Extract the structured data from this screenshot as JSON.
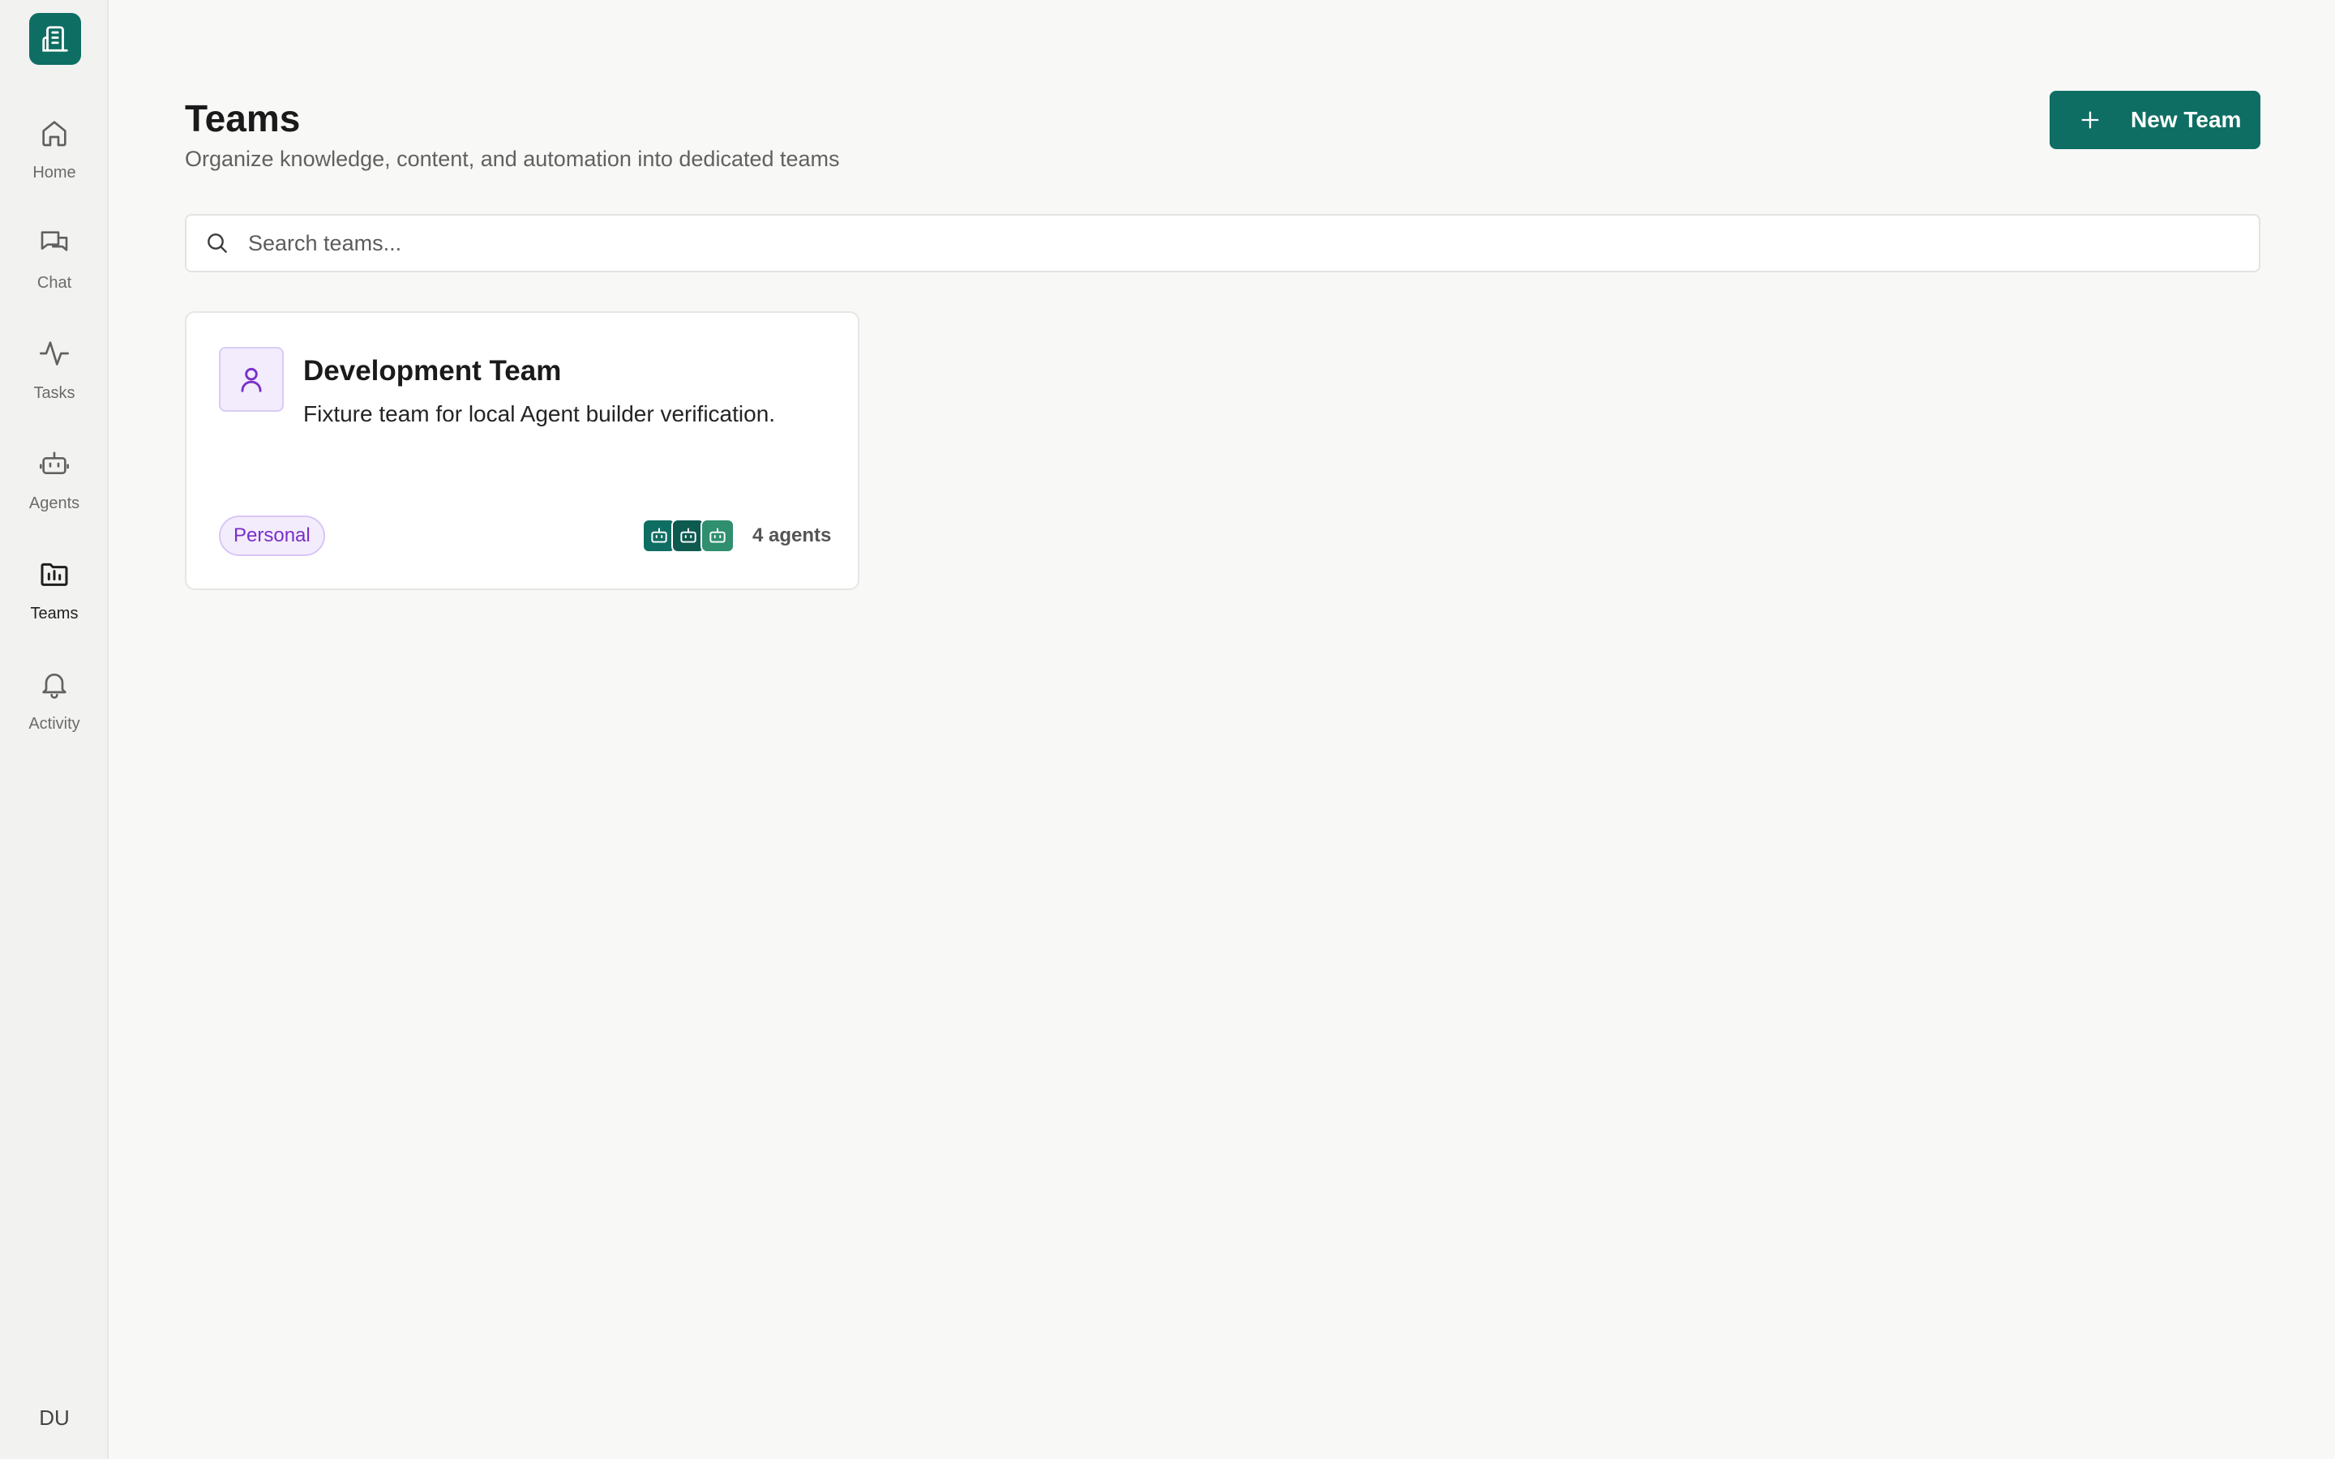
{
  "sidebar": {
    "logo": {
      "icon": "building-icon",
      "color": "#0f6e63"
    },
    "items": [
      {
        "label": "Home",
        "icon": "home-icon"
      },
      {
        "label": "Chat",
        "icon": "chat-icon"
      },
      {
        "label": "Tasks",
        "icon": "pulse-icon"
      },
      {
        "label": "Agents",
        "icon": "bot-icon"
      },
      {
        "label": "Teams",
        "icon": "folder-icon",
        "active": true
      },
      {
        "label": "Activity",
        "icon": "bell-icon"
      }
    ],
    "user_initials": "DU"
  },
  "header": {
    "title": "Teams",
    "subtitle": "Organize knowledge, content, and automation into dedicated teams",
    "new_team_label": "New Team"
  },
  "search": {
    "placeholder": "Search teams...",
    "value": ""
  },
  "teams": [
    {
      "name": "Development Team",
      "description": "Fixture team for local Agent builder verification.",
      "badge": "Personal",
      "agent_count_label": "4 agents",
      "agent_avatar_colors": [
        "#0f6e63",
        "#0d5a4f",
        "#2f8f6e"
      ]
    }
  ],
  "colors": {
    "accent": "#0f6e63",
    "badge_text": "#7a2fc7",
    "badge_bg": "#f3ecfd"
  }
}
